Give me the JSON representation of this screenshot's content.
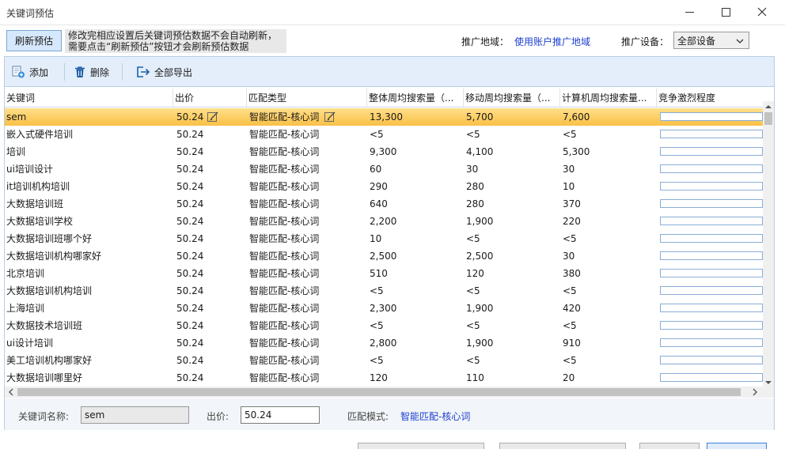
{
  "window": {
    "title": "关键词预估"
  },
  "top": {
    "refresh_label": "刷新预估",
    "notice_line1": "修改完相应设置后关键词预估数据不会自动刷新，",
    "notice_line2": "需要点击“刷新预估”按钮才会刷新预估数据",
    "region_label": "推广地域：",
    "region_value": "使用账户推广地域",
    "device_label": "推广设备：",
    "device_value": "全部设备"
  },
  "toolbar": {
    "add": "添加",
    "delete": "删除",
    "export": "全部导出"
  },
  "table": {
    "columns": [
      "关键词",
      "出价",
      "匹配类型",
      "整体周均搜索量（...",
      "移动周均搜索量（...",
      "计算机周均搜索量...",
      "竞争激烈程度"
    ],
    "rows": [
      {
        "kw": "sem",
        "bid": "50.24",
        "match": "智能匹配-核心词",
        "total": "13,300",
        "mobile": "5,700",
        "pc": "7,600",
        "selected": true
      },
      {
        "kw": "嵌入式硬件培训",
        "bid": "50.24",
        "match": "智能匹配-核心词",
        "total": "<5",
        "mobile": "<5",
        "pc": "<5"
      },
      {
        "kw": "培训",
        "bid": "50.24",
        "match": "智能匹配-核心词",
        "total": "9,300",
        "mobile": "4,100",
        "pc": "5,300"
      },
      {
        "kw": "ui培训设计",
        "bid": "50.24",
        "match": "智能匹配-核心词",
        "total": "60",
        "mobile": "30",
        "pc": "30"
      },
      {
        "kw": "it培训机构培训",
        "bid": "50.24",
        "match": "智能匹配-核心词",
        "total": "290",
        "mobile": "280",
        "pc": "10"
      },
      {
        "kw": "大数据培训班",
        "bid": "50.24",
        "match": "智能匹配-核心词",
        "total": "640",
        "mobile": "280",
        "pc": "370"
      },
      {
        "kw": "大数据培训学校",
        "bid": "50.24",
        "match": "智能匹配-核心词",
        "total": "2,200",
        "mobile": "1,900",
        "pc": "220"
      },
      {
        "kw": "大数据培训班哪个好",
        "bid": "50.24",
        "match": "智能匹配-核心词",
        "total": "10",
        "mobile": "<5",
        "pc": "<5"
      },
      {
        "kw": "大数据培训机构哪家好",
        "bid": "50.24",
        "match": "智能匹配-核心词",
        "total": "2,500",
        "mobile": "2,500",
        "pc": "30"
      },
      {
        "kw": "北京培训",
        "bid": "50.24",
        "match": "智能匹配-核心词",
        "total": "510",
        "mobile": "120",
        "pc": "380"
      },
      {
        "kw": "大数据培训机构培训",
        "bid": "50.24",
        "match": "智能匹配-核心词",
        "total": "<5",
        "mobile": "<5",
        "pc": "<5"
      },
      {
        "kw": "上海培训",
        "bid": "50.24",
        "match": "智能匹配-核心词",
        "total": "2,300",
        "mobile": "1,900",
        "pc": "420"
      },
      {
        "kw": "大数据技术培训班",
        "bid": "50.24",
        "match": "智能匹配-核心词",
        "total": "<5",
        "mobile": "<5",
        "pc": "<5"
      },
      {
        "kw": "ui设计培训",
        "bid": "50.24",
        "match": "智能匹配-核心词",
        "total": "2,800",
        "mobile": "1,900",
        "pc": "910"
      },
      {
        "kw": "美工培训机构哪家好",
        "bid": "50.24",
        "match": "智能匹配-核心词",
        "total": "<5",
        "mobile": "<5",
        "pc": "<5"
      },
      {
        "kw": "大数据培训哪里好",
        "bid": "50.24",
        "match": "智能匹配-核心词",
        "total": "120",
        "mobile": "110",
        "pc": "20"
      }
    ]
  },
  "form": {
    "name_label": "关键词名称:",
    "name_value": "sem",
    "price_label": "出价:",
    "price_value": "50.24",
    "match_label": "匹配模式:",
    "match_value": "智能匹配-核心词"
  },
  "colors": {
    "accent": "#1c3fcf",
    "toolbar_bg": "#e3eefa",
    "selected_row": "#f9c046"
  },
  "icons": {
    "add": "add-document-icon",
    "delete": "trash-icon",
    "export": "export-icon",
    "edit": "edit-pencil-icon"
  }
}
